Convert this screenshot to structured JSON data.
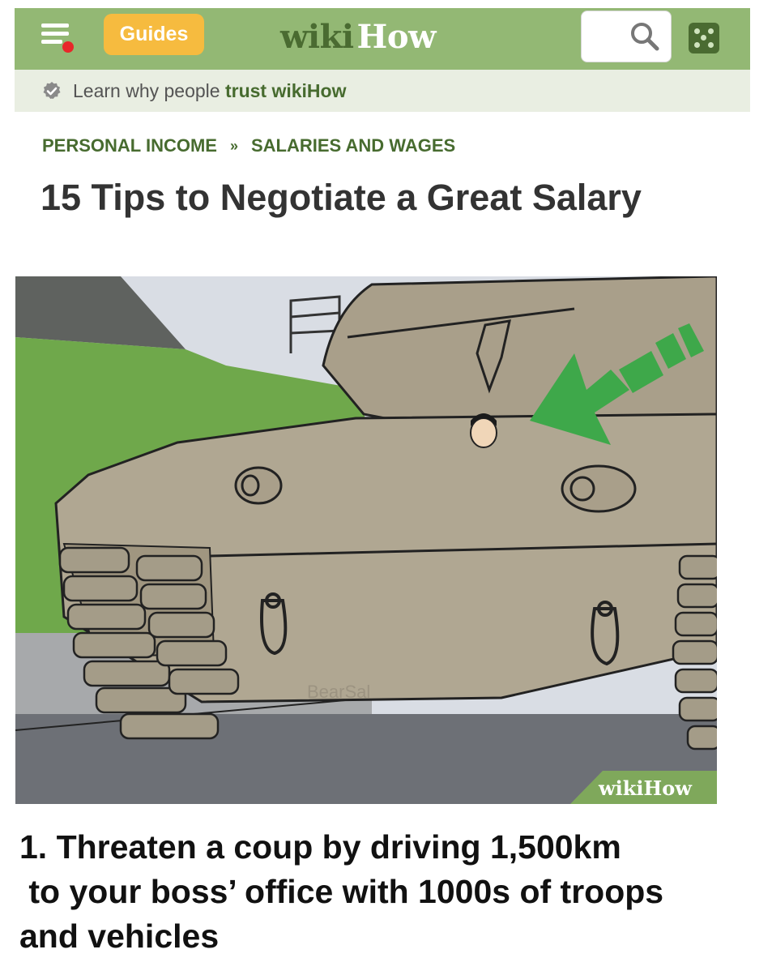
{
  "header": {
    "menu_icon": "hamburger-menu-icon",
    "notification_color": "#e8272a",
    "guides_label": "Guides",
    "logo_part1": "wiki",
    "logo_part2": "How",
    "search_icon": "search-icon",
    "random_icon": "dice-icon",
    "bar_color": "#93b874",
    "accent_color": "#f6bb3f"
  },
  "trust_bar": {
    "icon": "verified-check-icon",
    "text_prefix": "Learn why people ",
    "text_bold": "trust wikiHow"
  },
  "breadcrumbs": [
    {
      "label": "PERSONAL INCOME"
    },
    {
      "label": "SALARIES AND WAGES"
    }
  ],
  "breadcrumb_separator": "»",
  "article": {
    "title": "15 Tips to Negotiate a Great Salary",
    "image_watermark": "wikiHow",
    "image_faint_text": "BearSal",
    "step_caption": "1. Threaten a coup by driving 1,500km\n to your boss’ office with 1000s of troops\nand vehicles"
  }
}
